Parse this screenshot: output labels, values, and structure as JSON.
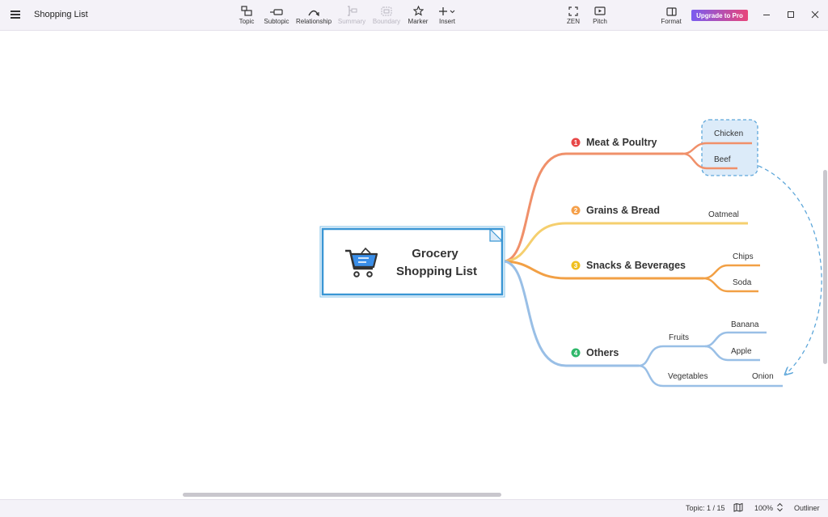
{
  "window": {
    "title": "Shopping List"
  },
  "toolbar": {
    "topic": "Topic",
    "subtopic": "Subtopic",
    "relationship": "Relationship",
    "summary": "Summary",
    "boundary": "Boundary",
    "marker": "Marker",
    "insert": "Insert",
    "zen": "ZEN",
    "pitch": "Pitch",
    "format": "Format",
    "upgrade": "Upgrade to Pro"
  },
  "mindmap": {
    "central": {
      "line1": "Grocery",
      "line2": "Shopping List"
    },
    "branches": [
      {
        "number": "1",
        "label": "Meat & Poultry",
        "color": "#f0906a",
        "badge": "#e84848",
        "children": [
          "Chicken",
          "Beef"
        ]
      },
      {
        "number": "2",
        "label": "Grains & Bread",
        "color": "#f5cf6e",
        "badge": "#f5a04a",
        "children": [
          "Oatmeal"
        ]
      },
      {
        "number": "3",
        "label": "Snacks & Beverages",
        "color": "#f2a045",
        "badge": "#f0c020",
        "children": [
          "Chips",
          "Soda"
        ]
      },
      {
        "number": "4",
        "label": "Others",
        "color": "#99bfe6",
        "badge": "#2fb86a",
        "subgroups": [
          {
            "label": "Fruits",
            "children": [
              "Banana",
              "Apple"
            ]
          },
          {
            "label": "Vegetables",
            "children": [
              "Onion"
            ]
          }
        ]
      }
    ]
  },
  "status": {
    "topic_count": "Topic: 1 / 15",
    "zoom": "100%",
    "outliner": "Outliner"
  }
}
